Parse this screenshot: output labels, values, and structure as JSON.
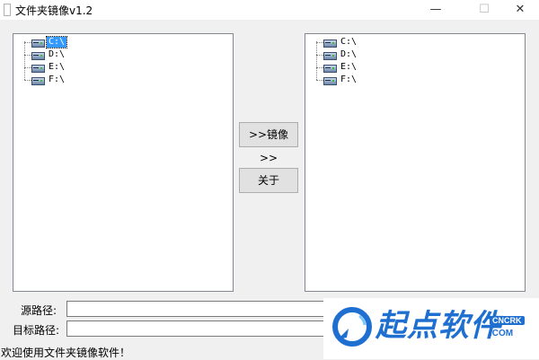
{
  "window": {
    "title": "文件夹镜像v1.2",
    "minimize": "—",
    "maximize": "☐",
    "close": "✕"
  },
  "left_tree": {
    "items": [
      {
        "label": "C:\\",
        "selected": true
      },
      {
        "label": "D:\\",
        "selected": false
      },
      {
        "label": "E:\\",
        "selected": false
      },
      {
        "label": "F:\\",
        "selected": false
      }
    ]
  },
  "right_tree": {
    "items": [
      {
        "label": "C:\\"
      },
      {
        "label": "D:\\"
      },
      {
        "label": "E:\\"
      },
      {
        "label": "F:\\"
      }
    ]
  },
  "buttons": {
    "mirror": ">>镜像>>",
    "about": "关于"
  },
  "fields": {
    "source_label": "源路径:",
    "source_value": "",
    "target_label": "目标路径:",
    "target_value": ""
  },
  "status": "欢迎使用文件夹镜像软件！",
  "watermark": {
    "text": "起点软件",
    "badge": "CNCRK",
    "sub": ".COM"
  }
}
